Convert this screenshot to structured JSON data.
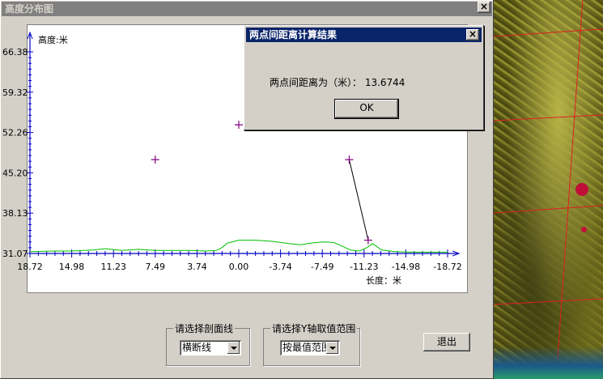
{
  "main_window": {
    "title": "高度分布图",
    "close_glyph": "×"
  },
  "chart_data": {
    "type": "line",
    "xlabel": "长度：米",
    "ylabel": "高度:米",
    "xlim": [
      18.72,
      -18.72
    ],
    "ylim": [
      31.07,
      66.38
    ],
    "x_ticks": [
      "18.72",
      "14.98",
      "11.23",
      "7.49",
      "3.74",
      "0.00",
      "-3.74",
      "-7.49",
      "-11.23",
      "-14.98",
      "-18.72"
    ],
    "y_ticks": [
      "66.38",
      "59.32",
      "52.26",
      "45.20",
      "38.13",
      "31.07"
    ],
    "series": [
      {
        "color": "#00c000",
        "x": [
          18.72,
          16.5,
          15.0,
          13.0,
          12.0,
          10.5,
          9.0,
          7.5,
          6.0,
          4.5,
          3.0,
          2.0,
          1.5,
          1.0,
          0.0,
          -1.5,
          -3.0,
          -4.5,
          -5.5,
          -6.5,
          -7.5,
          -8.5,
          -9.2,
          -10.0,
          -10.8,
          -11.5,
          -12.0,
          -12.8,
          -14.0,
          -15.5,
          -17.0,
          -18.72
        ],
        "y": [
          31.4,
          31.5,
          31.5,
          31.7,
          31.9,
          31.6,
          31.8,
          31.6,
          31.6,
          31.6,
          31.5,
          31.6,
          32.1,
          32.9,
          33.4,
          33.4,
          33.2,
          32.8,
          32.6,
          32.9,
          33.1,
          33.0,
          32.4,
          31.7,
          31.5,
          32.1,
          32.8,
          31.7,
          31.4,
          31.3,
          31.3,
          31.3
        ]
      }
    ],
    "markers": [
      {
        "x": 7.49,
        "y": 47.5
      },
      {
        "x": 0.0,
        "y": 53.6
      },
      {
        "x": -9.9,
        "y": 47.5
      },
      {
        "x": -11.6,
        "y": 33.4
      }
    ],
    "measure_line": {
      "from": [
        -9.9,
        47.5
      ],
      "to": [
        -11.6,
        33.4
      ],
      "color": "#000000"
    },
    "marker_color": "#800080"
  },
  "controls": {
    "profile_group_label": "请选择剖面线",
    "profile_value": "横断线",
    "yrange_group_label": "请选择Y轴取值范围",
    "yrange_value": "按最值范围",
    "exit_label": "退出"
  },
  "result_dialog": {
    "title": "两点间距离计算结果",
    "message": "两点间距离为（米）：  13.6744",
    "ok_label": "OK",
    "close_glyph": "×"
  },
  "colors": {
    "active_titlebar": "#0a246a",
    "inactive_titlebar": "#808080",
    "face": "#d4d0c8",
    "map_gridline": "#e02020"
  }
}
